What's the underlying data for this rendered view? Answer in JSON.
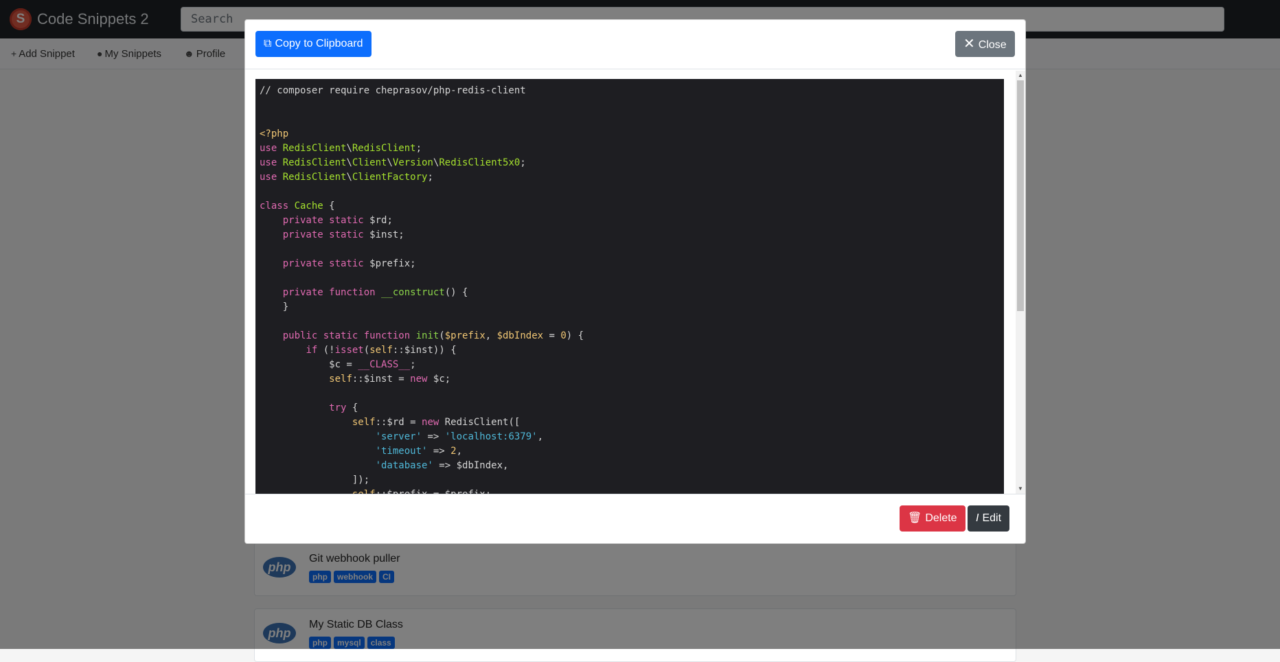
{
  "app": {
    "brand_initial": "S",
    "title": "Code Snippets 2",
    "search_placeholder": "Search"
  },
  "nav": [
    {
      "label": "Add Snippet",
      "icon": "plus-icon"
    },
    {
      "label": "My Snippets",
      "icon": "toggle-icon"
    },
    {
      "label": "Profile",
      "icon": "person-icon"
    }
  ],
  "snippets": [
    {
      "title": "Git webhook puller",
      "lang": "php",
      "tags": [
        "php",
        "webhook",
        "CI"
      ]
    },
    {
      "title": "My Static DB Class",
      "lang": "php",
      "tags": [
        "php",
        "mysql",
        "class"
      ]
    }
  ],
  "modal": {
    "copy_label": "Copy to Clipboard",
    "close_label": "Close",
    "delete_label": "Delete",
    "edit_label": "Edit"
  },
  "code_lines": [
    [
      [
        "c-com",
        "// composer require cheprasov/php-redis-client"
      ]
    ],
    [],
    [],
    [
      [
        "c-tag",
        "<?php"
      ]
    ],
    [
      [
        "c-kw",
        "use "
      ],
      [
        "c-ns",
        "RedisClient"
      ],
      [
        "",
        "\\"
      ],
      [
        "c-ns",
        "RedisClient"
      ],
      [
        "",
        ";"
      ]
    ],
    [
      [
        "c-kw",
        "use "
      ],
      [
        "c-ns",
        "RedisClient"
      ],
      [
        "",
        "\\"
      ],
      [
        "c-ns",
        "Client"
      ],
      [
        "",
        "\\"
      ],
      [
        "c-ns",
        "Version"
      ],
      [
        "",
        "\\"
      ],
      [
        "c-ns",
        "RedisClient5x0"
      ],
      [
        "",
        ";"
      ]
    ],
    [
      [
        "c-kw",
        "use "
      ],
      [
        "c-ns",
        "RedisClient"
      ],
      [
        "",
        "\\"
      ],
      [
        "c-ns",
        "ClientFactory"
      ],
      [
        "",
        ";"
      ]
    ],
    [],
    [
      [
        "c-kw",
        "class "
      ],
      [
        "c-ns",
        "Cache"
      ],
      [
        "",
        " {"
      ]
    ],
    [
      [
        "",
        "    "
      ],
      [
        "c-kw",
        "private static "
      ],
      [
        "",
        "$rd;"
      ]
    ],
    [
      [
        "",
        "    "
      ],
      [
        "c-kw",
        "private static "
      ],
      [
        "",
        "$inst;"
      ]
    ],
    [],
    [
      [
        "",
        "    "
      ],
      [
        "c-kw",
        "private static "
      ],
      [
        "",
        "$prefix;"
      ]
    ],
    [],
    [
      [
        "",
        "    "
      ],
      [
        "c-kw",
        "private function "
      ],
      [
        "c-fn",
        "__construct"
      ],
      [
        "",
        "() {"
      ]
    ],
    [
      [
        "",
        "    }"
      ]
    ],
    [],
    [
      [
        "",
        "    "
      ],
      [
        "c-kw",
        "public static function "
      ],
      [
        "c-fn",
        "init"
      ],
      [
        "",
        "("
      ],
      [
        "c-var",
        "$prefix"
      ],
      [
        "",
        ", "
      ],
      [
        "c-var",
        "$dbIndex"
      ],
      [
        "",
        " = "
      ],
      [
        "c-num",
        "0"
      ],
      [
        "",
        ") {"
      ]
    ],
    [
      [
        "",
        "        "
      ],
      [
        "c-kw",
        "if"
      ],
      [
        "",
        " (!"
      ],
      [
        "c-kw",
        "isset"
      ],
      [
        "",
        "("
      ],
      [
        "c-var",
        "self"
      ],
      [
        "",
        "::$inst)) {"
      ]
    ],
    [
      [
        "",
        "            $c = "
      ],
      [
        "c-mag",
        "__CLASS__"
      ],
      [
        "",
        ";"
      ]
    ],
    [
      [
        "",
        "            "
      ],
      [
        "c-var",
        "self"
      ],
      [
        "",
        "::$inst = "
      ],
      [
        "c-kw",
        "new"
      ],
      [
        "",
        " $c;"
      ]
    ],
    [],
    [
      [
        "",
        "            "
      ],
      [
        "c-kw",
        "try"
      ],
      [
        "",
        " {"
      ]
    ],
    [
      [
        "",
        "                "
      ],
      [
        "c-var",
        "self"
      ],
      [
        "",
        "::$rd = "
      ],
      [
        "c-kw",
        "new"
      ],
      [
        "",
        " RedisClient(["
      ]
    ],
    [
      [
        "",
        "                    "
      ],
      [
        "c-str",
        "'server'"
      ],
      [
        "",
        " => "
      ],
      [
        "c-str",
        "'localhost:6379'"
      ],
      [
        "",
        ","
      ]
    ],
    [
      [
        "",
        "                    "
      ],
      [
        "c-str",
        "'timeout'"
      ],
      [
        "",
        " => "
      ],
      [
        "c-num",
        "2"
      ],
      [
        "",
        ","
      ]
    ],
    [
      [
        "",
        "                    "
      ],
      [
        "c-str",
        "'database'"
      ],
      [
        "",
        " => $dbIndex,"
      ]
    ],
    [
      [
        "",
        "                ]);"
      ]
    ],
    [
      [
        "",
        "                "
      ],
      [
        "c-var",
        "self"
      ],
      [
        "",
        "::$prefix = $prefix;"
      ]
    ]
  ]
}
